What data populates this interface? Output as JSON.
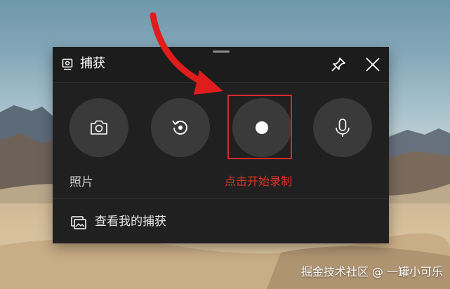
{
  "widget": {
    "title": "捕获",
    "icons": {
      "title": "capture-widget-icon",
      "pin": "pin-icon",
      "close": "close-icon",
      "screenshot": "camera-icon",
      "replay": "replay-icon",
      "record": "record-dot-icon",
      "mic": "microphone-icon",
      "gallery": "gallery-icon"
    },
    "photo_label": "照片",
    "gallery_label": "查看我的捕获"
  },
  "annotation": {
    "text": "点击开始录制",
    "color": "#e0322a",
    "arrow_color": "#e01c1c"
  },
  "watermark": "掘金技术社区 @ 一罐小可乐"
}
